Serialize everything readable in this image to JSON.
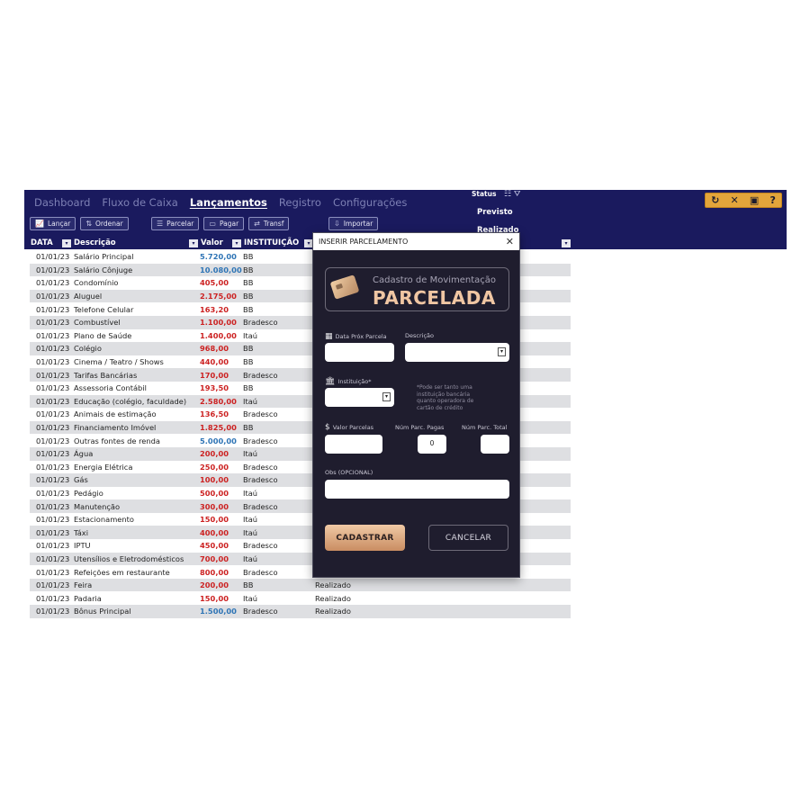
{
  "nav": {
    "items": [
      {
        "label": "Dashboard"
      },
      {
        "label": "Fluxo de Caixa"
      },
      {
        "label": "Lançamentos",
        "active": true
      },
      {
        "label": "Registro"
      },
      {
        "label": "Configurações"
      }
    ]
  },
  "toolbar": {
    "lancar": "Lançar",
    "ordenar": "Ordenar",
    "parcelar": "Parcelar",
    "pagar": "Pagar",
    "transf": "Transf",
    "importar": "Importar"
  },
  "status_filter": {
    "label": "Status",
    "option_1": "Previsto",
    "option_2": "Realizado"
  },
  "window_controls": [
    "refresh-icon",
    "collapse-icon",
    "restore-icon",
    "help-icon"
  ],
  "columns": {
    "data": "DATA",
    "descricao": "Descrição",
    "valor": "Valor",
    "instituicao": "INSTITUIÇÃO"
  },
  "rows": [
    {
      "date": "01/01/23",
      "desc": "Salário Principal",
      "value": "5.720,00",
      "kind": "pos",
      "inst": "BB",
      "status": ""
    },
    {
      "date": "01/01/23",
      "desc": "Salário Cônjuge",
      "value": "10.080,00",
      "kind": "pos",
      "inst": "BB",
      "status": ""
    },
    {
      "date": "01/01/23",
      "desc": "Condomínio",
      "value": "405,00",
      "kind": "neg",
      "inst": "BB",
      "status": ""
    },
    {
      "date": "01/01/23",
      "desc": "Aluguel",
      "value": "2.175,00",
      "kind": "neg",
      "inst": "BB",
      "status": ""
    },
    {
      "date": "01/01/23",
      "desc": "Telefone Celular",
      "value": "163,20",
      "kind": "neg",
      "inst": "BB",
      "status": ""
    },
    {
      "date": "01/01/23",
      "desc": "Combustível",
      "value": "1.100,00",
      "kind": "neg",
      "inst": "Bradesco",
      "status": ""
    },
    {
      "date": "01/01/23",
      "desc": "Plano de Saúde",
      "value": "1.400,00",
      "kind": "neg",
      "inst": "Itaú",
      "status": ""
    },
    {
      "date": "01/01/23",
      "desc": "Colégio",
      "value": "968,00",
      "kind": "neg",
      "inst": "BB",
      "status": ""
    },
    {
      "date": "01/01/23",
      "desc": "Cinema / Teatro / Shows",
      "value": "440,00",
      "kind": "neg",
      "inst": "BB",
      "status": ""
    },
    {
      "date": "01/01/23",
      "desc": "Tarifas Bancárias",
      "value": "170,00",
      "kind": "neg",
      "inst": "Bradesco",
      "status": ""
    },
    {
      "date": "01/01/23",
      "desc": "Assessoria Contábil",
      "value": "193,50",
      "kind": "neg",
      "inst": "BB",
      "status": ""
    },
    {
      "date": "01/01/23",
      "desc": "Educação (colégio, faculdade)",
      "value": "2.580,00",
      "kind": "neg",
      "inst": "Itaú",
      "status": ""
    },
    {
      "date": "01/01/23",
      "desc": "Animais de estimação",
      "value": "136,50",
      "kind": "neg",
      "inst": "Bradesco",
      "status": ""
    },
    {
      "date": "01/01/23",
      "desc": "Financiamento Imóvel",
      "value": "1.825,00",
      "kind": "neg",
      "inst": "BB",
      "status": ""
    },
    {
      "date": "01/01/23",
      "desc": "Outras fontes de renda",
      "value": "5.000,00",
      "kind": "pos",
      "inst": "Bradesco",
      "status": ""
    },
    {
      "date": "01/01/23",
      "desc": "Água",
      "value": "200,00",
      "kind": "neg",
      "inst": "Itaú",
      "status": ""
    },
    {
      "date": "01/01/23",
      "desc": "Energia Elétrica",
      "value": "250,00",
      "kind": "neg",
      "inst": "Bradesco",
      "status": ""
    },
    {
      "date": "01/01/23",
      "desc": "Gás",
      "value": "100,00",
      "kind": "neg",
      "inst": "Bradesco",
      "status": ""
    },
    {
      "date": "01/01/23",
      "desc": "Pedágio",
      "value": "500,00",
      "kind": "neg",
      "inst": "Itaú",
      "status": ""
    },
    {
      "date": "01/01/23",
      "desc": "Manutenção",
      "value": "300,00",
      "kind": "neg",
      "inst": "Bradesco",
      "status": ""
    },
    {
      "date": "01/01/23",
      "desc": "Estacionamento",
      "value": "150,00",
      "kind": "neg",
      "inst": "Itaú",
      "status": ""
    },
    {
      "date": "01/01/23",
      "desc": "Táxi",
      "value": "400,00",
      "kind": "neg",
      "inst": "Itaú",
      "status": ""
    },
    {
      "date": "01/01/23",
      "desc": "IPTU",
      "value": "450,00",
      "kind": "neg",
      "inst": "Bradesco",
      "status": ""
    },
    {
      "date": "01/01/23",
      "desc": "Utensílios e Eletrodomésticos",
      "value": "700,00",
      "kind": "neg",
      "inst": "Itaú",
      "status": ""
    },
    {
      "date": "01/01/23",
      "desc": "Refeições em restaurante",
      "value": "800,00",
      "kind": "neg",
      "inst": "Bradesco",
      "status": ""
    },
    {
      "date": "01/01/23",
      "desc": "Feira",
      "value": "200,00",
      "kind": "neg",
      "inst": "BB",
      "status": "Realizado"
    },
    {
      "date": "01/01/23",
      "desc": "Padaria",
      "value": "150,00",
      "kind": "neg",
      "inst": "Itaú",
      "status": "Realizado"
    },
    {
      "date": "01/01/23",
      "desc": "Bônus Principal",
      "value": "1.500,00",
      "kind": "pos",
      "inst": "Bradesco",
      "status": "Realizado"
    }
  ],
  "modal": {
    "title": "INSERIR PARCELAMENTO",
    "banner_sub": "Cadastro de Movimentação",
    "banner_big": "PARCELADA",
    "label_data": "Data Próx Parcela",
    "label_desc": "Descrição",
    "label_inst": "Instituição*",
    "hint": "*Pode ser tanto uma instituição bancária quanto operadora de cartão de crédito",
    "label_valor": "Valor Parcelas",
    "label_pagas": "Núm Parc. Pagas",
    "value_pagas": "0",
    "label_total": "Núm Parc. Total",
    "label_obs": "Obs (OPCIONAL)",
    "btn_cadastrar": "CADASTRAR",
    "btn_cancelar": "CANCELAR"
  },
  "colors": {
    "navy": "#1a1a5e",
    "positive": "#2e74b5",
    "negative": "#cc2222",
    "accent_copper": "#f0c6a3",
    "modal_bg": "#1f1d2e"
  }
}
